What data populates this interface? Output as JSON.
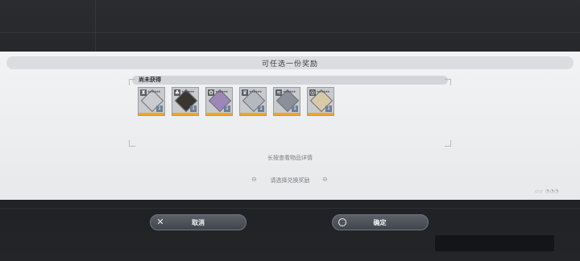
{
  "dialog": {
    "title": "可任选一份奖励",
    "section_label": "尚未获得",
    "hint_long_press": "长按查看物品详情",
    "hint_select": "请选择兑换奖励",
    "arrow_left": "⊖",
    "arrow_right": "⊖"
  },
  "items": [
    {
      "type": "ghost-icon",
      "type_glyph": "♜",
      "count": "1",
      "portrait_color": "#c9cbd0"
    },
    {
      "type": "ghost-icon",
      "type_glyph": "♣",
      "count": "1",
      "portrait_color": "#3a3530"
    },
    {
      "type": "flower-icon",
      "type_glyph": "✿",
      "count": "1",
      "portrait_color": "#9d86b8"
    },
    {
      "type": "crown-icon",
      "type_glyph": "♛",
      "count": "1",
      "portrait_color": "#b4b8c0"
    },
    {
      "type": "wave-icon",
      "type_glyph": "≋",
      "count": "1",
      "portrait_color": "#8a8f9a"
    },
    {
      "type": "spiral-icon",
      "type_glyph": "◎",
      "count": "1",
      "portrait_color": "#d8c9a8"
    }
  ],
  "stars": "★★★★★★",
  "buttons": {
    "cancel_label": "取消",
    "confirm_label": "确定"
  },
  "colors": {
    "accent_orange": "#f0a623",
    "panel_bg": "#eeeff1",
    "button_bg": "#4a4e56"
  }
}
